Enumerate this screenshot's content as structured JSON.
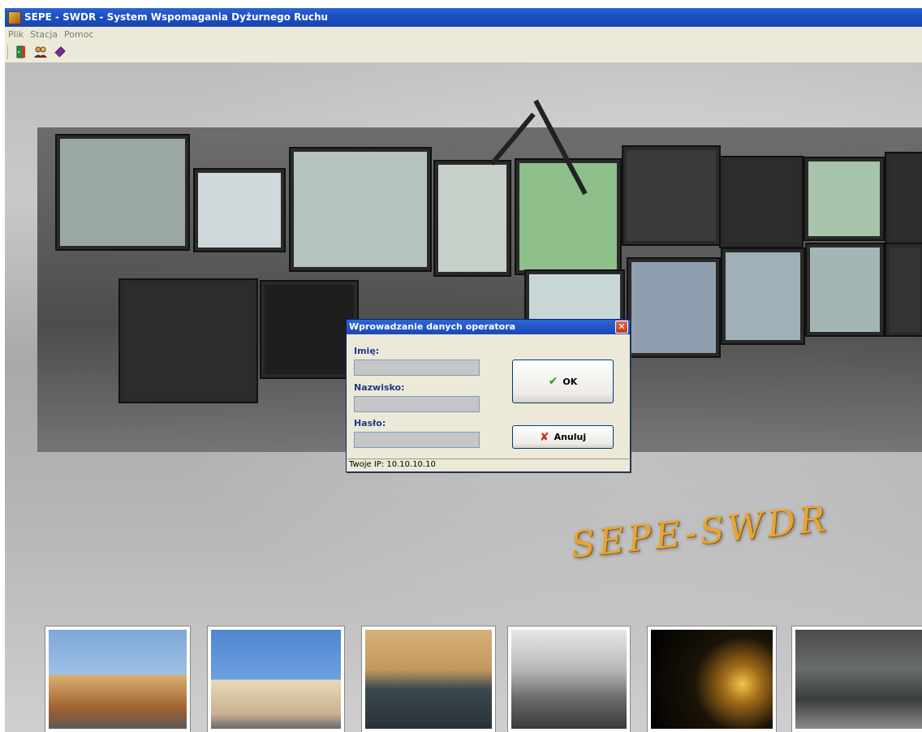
{
  "window": {
    "title": "SEPE - SWDR - System Wspomagania Dyżurnego Ruchu"
  },
  "menu": [
    "Plik",
    "Stacja",
    "Pomoc"
  ],
  "toolbar": {
    "icons": [
      "exit-door-icon",
      "users-icon",
      "book-icon"
    ]
  },
  "branding": {
    "logo_text": "SEPE-SWDR"
  },
  "dialog": {
    "title": "Wprowadzanie danych operatora",
    "fields": [
      {
        "label": "Imię:",
        "value": ""
      },
      {
        "label": "Nazwisko:",
        "value": ""
      },
      {
        "label": "Hasło:",
        "value": ""
      }
    ],
    "ok_label": "OK",
    "cancel_label": "Anuluj",
    "status": "Twoje IP: 10.10.10.10"
  },
  "colors": {
    "title_bar": "#1c4fbf",
    "dialog_bg": "#ece9d8",
    "label_blue": "#1f3a8c",
    "logo": "#e8a532",
    "ok_check": "#2e9a18",
    "cancel_x": "#c8281a"
  }
}
